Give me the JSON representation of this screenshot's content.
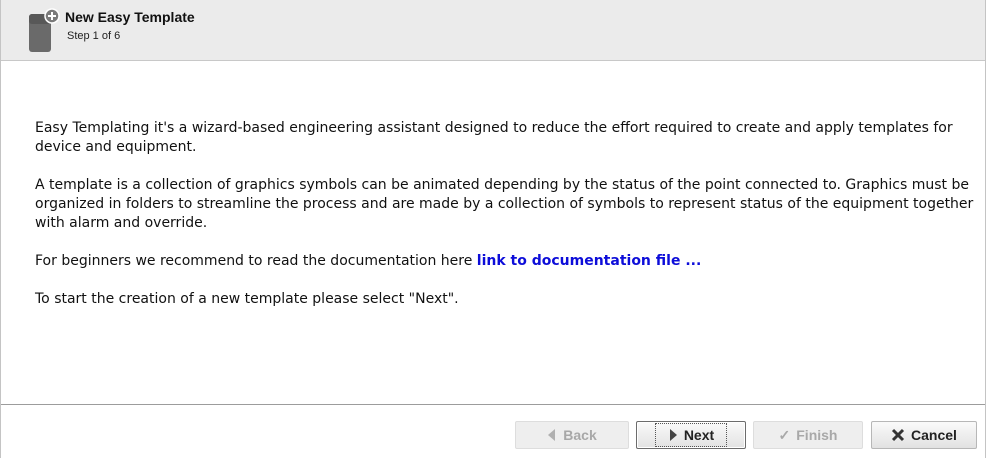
{
  "header": {
    "title": "New Easy Template",
    "step": "Step 1 of 6",
    "icon": "new-template-icon"
  },
  "content": {
    "paragraph1": "Easy Templating it's a wizard-based engineering assistant designed to reduce the effort required to create and apply templates for device and equipment.",
    "paragraph2": "A template is a collection of graphics symbols can be animated depending by the status of the point connected to. Graphics must be organized in folders to streamline the process and are made by a collection of symbols to represent status of the equipment together with alarm and override.",
    "paragraph3_prefix": "For beginners we recommend to read the documentation here ",
    "doc_link": "link to documentation file ...",
    "paragraph4": "To start the creation of a new template please select \"Next\"."
  },
  "buttons": {
    "back": "Back",
    "next": "Next",
    "finish": "Finish",
    "cancel": "Cancel"
  },
  "colors": {
    "link": "#0d0dd9",
    "header_bg": "#ebebeb"
  }
}
